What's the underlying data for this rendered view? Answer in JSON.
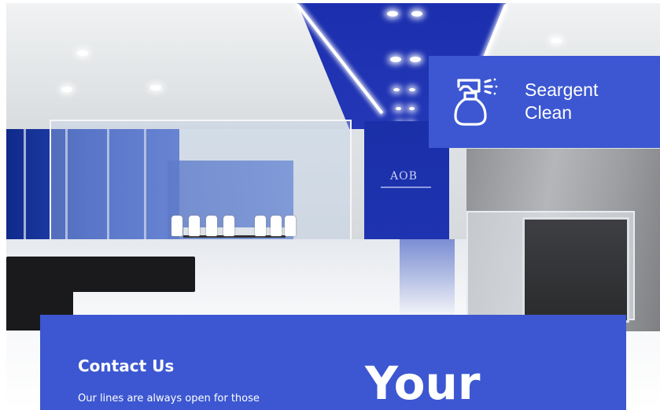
{
  "brand": {
    "name_line1": "Seargent",
    "name_line2": "Clean",
    "icon": "spray-bottle-icon"
  },
  "contact": {
    "heading": "Contact Us",
    "text": "Our lines are always open for those"
  },
  "headline": {
    "text": "Your"
  },
  "colors": {
    "panel_blue": "#3c57d1",
    "text_white": "#ffffff"
  }
}
